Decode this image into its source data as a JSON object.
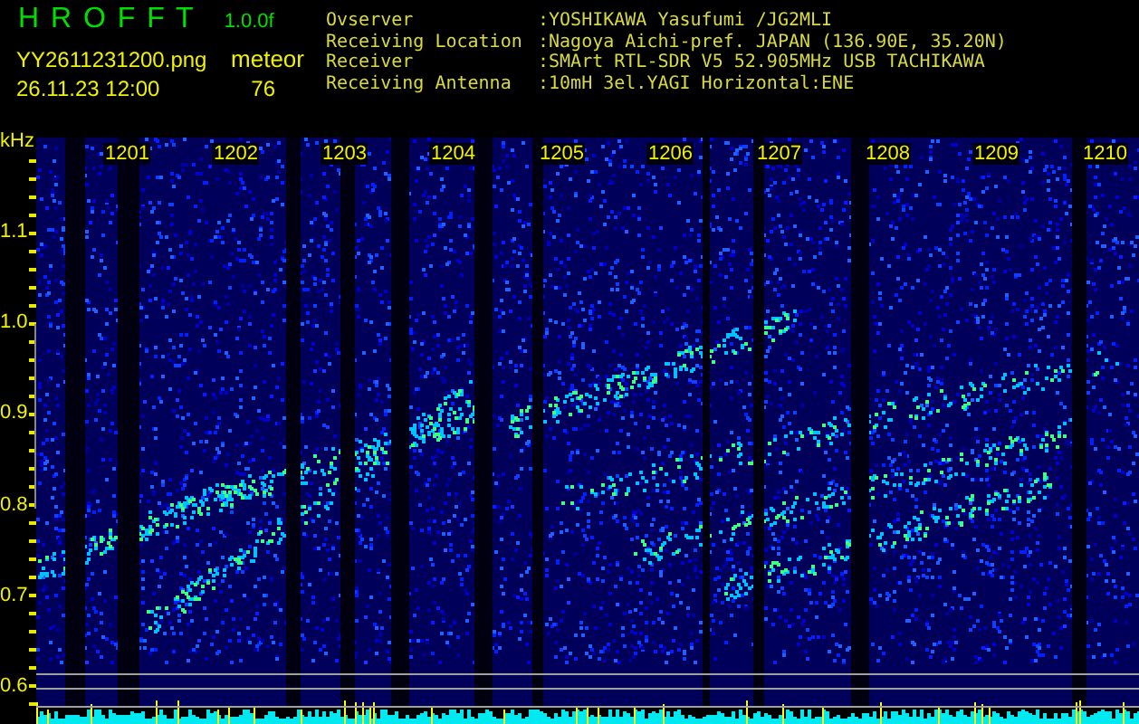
{
  "app": {
    "title": "H R O F F T",
    "version": "1.0.0f"
  },
  "file": {
    "name": "YY2611231200.png",
    "datetime": "26.11.23 12:00"
  },
  "counter": {
    "label": "meteor",
    "count": "76"
  },
  "station": [
    {
      "label": "Ovserver",
      "value": ":YOSHIKAWA Yasufumi /JG2MLI"
    },
    {
      "label": "Receiving Location",
      "value": ":Nagoya Aichi-pref. JAPAN (136.90E, 35.20N)"
    },
    {
      "label": "Receiver",
      "value": ":SMArt RTL-SDR V5 52.905MHz USB TACHIKAWA"
    },
    {
      "label": "Receiving Antenna",
      "value": ":10mH 3el.YAGI Horizontal:ENE"
    }
  ],
  "spectrogram": {
    "unit": "kHz",
    "yticks": [
      "1.1",
      "1.0",
      "0.9",
      "0.8",
      "0.7",
      "0.6"
    ],
    "xticks": [
      "1201",
      "1202",
      "1203",
      "1204",
      "1205",
      "1206",
      "1207",
      "1208",
      "1209",
      "1210"
    ]
  }
}
